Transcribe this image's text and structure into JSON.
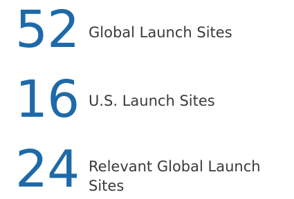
{
  "stats": [
    {
      "number": "52",
      "label": "Global Launch Sites"
    },
    {
      "number": "16",
      "label": "U.S. Launch Sites"
    },
    {
      "number": "24",
      "label": "Relevant Global Launch Sites"
    }
  ],
  "colors": {
    "number": "#1e6aa8",
    "label": "#3a3a3a",
    "background": "#ffffff"
  }
}
